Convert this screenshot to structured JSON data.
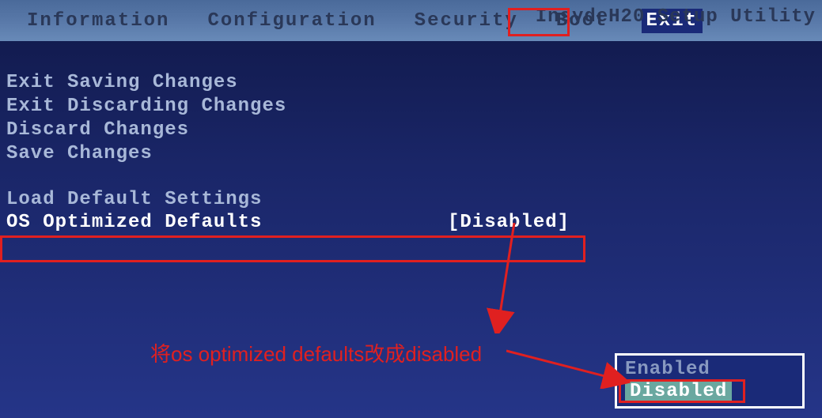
{
  "header": {
    "utility_name": "InsydeH20 Setup Utility",
    "tabs": [
      {
        "label": "Information"
      },
      {
        "label": "Configuration"
      },
      {
        "label": "Security"
      },
      {
        "label": "Boot"
      },
      {
        "label": "Exit",
        "selected": true
      }
    ]
  },
  "exit_menu": {
    "items": [
      "Exit Saving Changes",
      "Exit Discarding Changes",
      "Discard Changes",
      "Save Changes"
    ],
    "load_defaults": "Load Default Settings",
    "os_optimized": {
      "label": "OS Optimized Defaults",
      "value": "[Disabled]"
    }
  },
  "popup": {
    "options": [
      {
        "label": "Enabled",
        "selected": false
      },
      {
        "label": "Disabled",
        "selected": true
      }
    ]
  },
  "annotation": {
    "text": "将os optimized defaults改成disabled"
  }
}
